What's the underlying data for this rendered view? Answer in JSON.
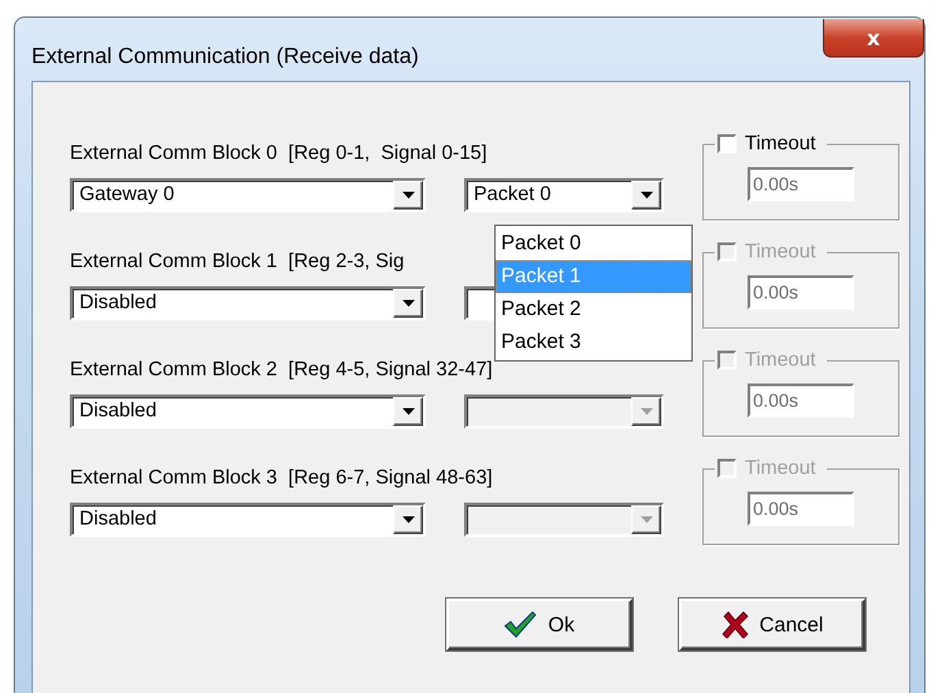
{
  "window": {
    "title": "External Communication (Receive data)",
    "close_label": "x"
  },
  "blocks": [
    {
      "label": "External Comm Block 0  [Reg 0-1,  Signal 0-15]",
      "source": "Gateway 0",
      "packet": "Packet 0",
      "packet_enabled": true,
      "timeout": {
        "label": "Timeout",
        "checked": false,
        "enabled": true,
        "value": "0.00s"
      }
    },
    {
      "label": "External Comm Block 1  [Reg 2-3, Sig",
      "source": "Disabled",
      "packet_enabled": true,
      "timeout": {
        "label": "Timeout",
        "checked": false,
        "enabled": false,
        "value": "0.00s"
      }
    },
    {
      "label": "External Comm Block 2  [Reg 4-5, Signal 32-47]",
      "source": "Disabled",
      "packet_enabled": false,
      "timeout": {
        "label": "Timeout",
        "checked": false,
        "enabled": false,
        "value": "0.00s"
      }
    },
    {
      "label": "External Comm Block 3  [Reg 6-7, Signal 48-63]",
      "source": "Disabled",
      "packet_enabled": false,
      "timeout": {
        "label": "Timeout",
        "checked": false,
        "enabled": false,
        "value": "0.00s"
      }
    }
  ],
  "packet_list": {
    "items": [
      {
        "label": "Packet 0",
        "selected": false
      },
      {
        "label": "Packet 1",
        "selected": true
      },
      {
        "label": "Packet 2",
        "selected": false
      },
      {
        "label": "Packet 3",
        "selected": false
      }
    ]
  },
  "buttons": [
    {
      "label": "Ok",
      "kind": "ok"
    },
    {
      "label": "Cancel",
      "kind": "cancel"
    }
  ]
}
